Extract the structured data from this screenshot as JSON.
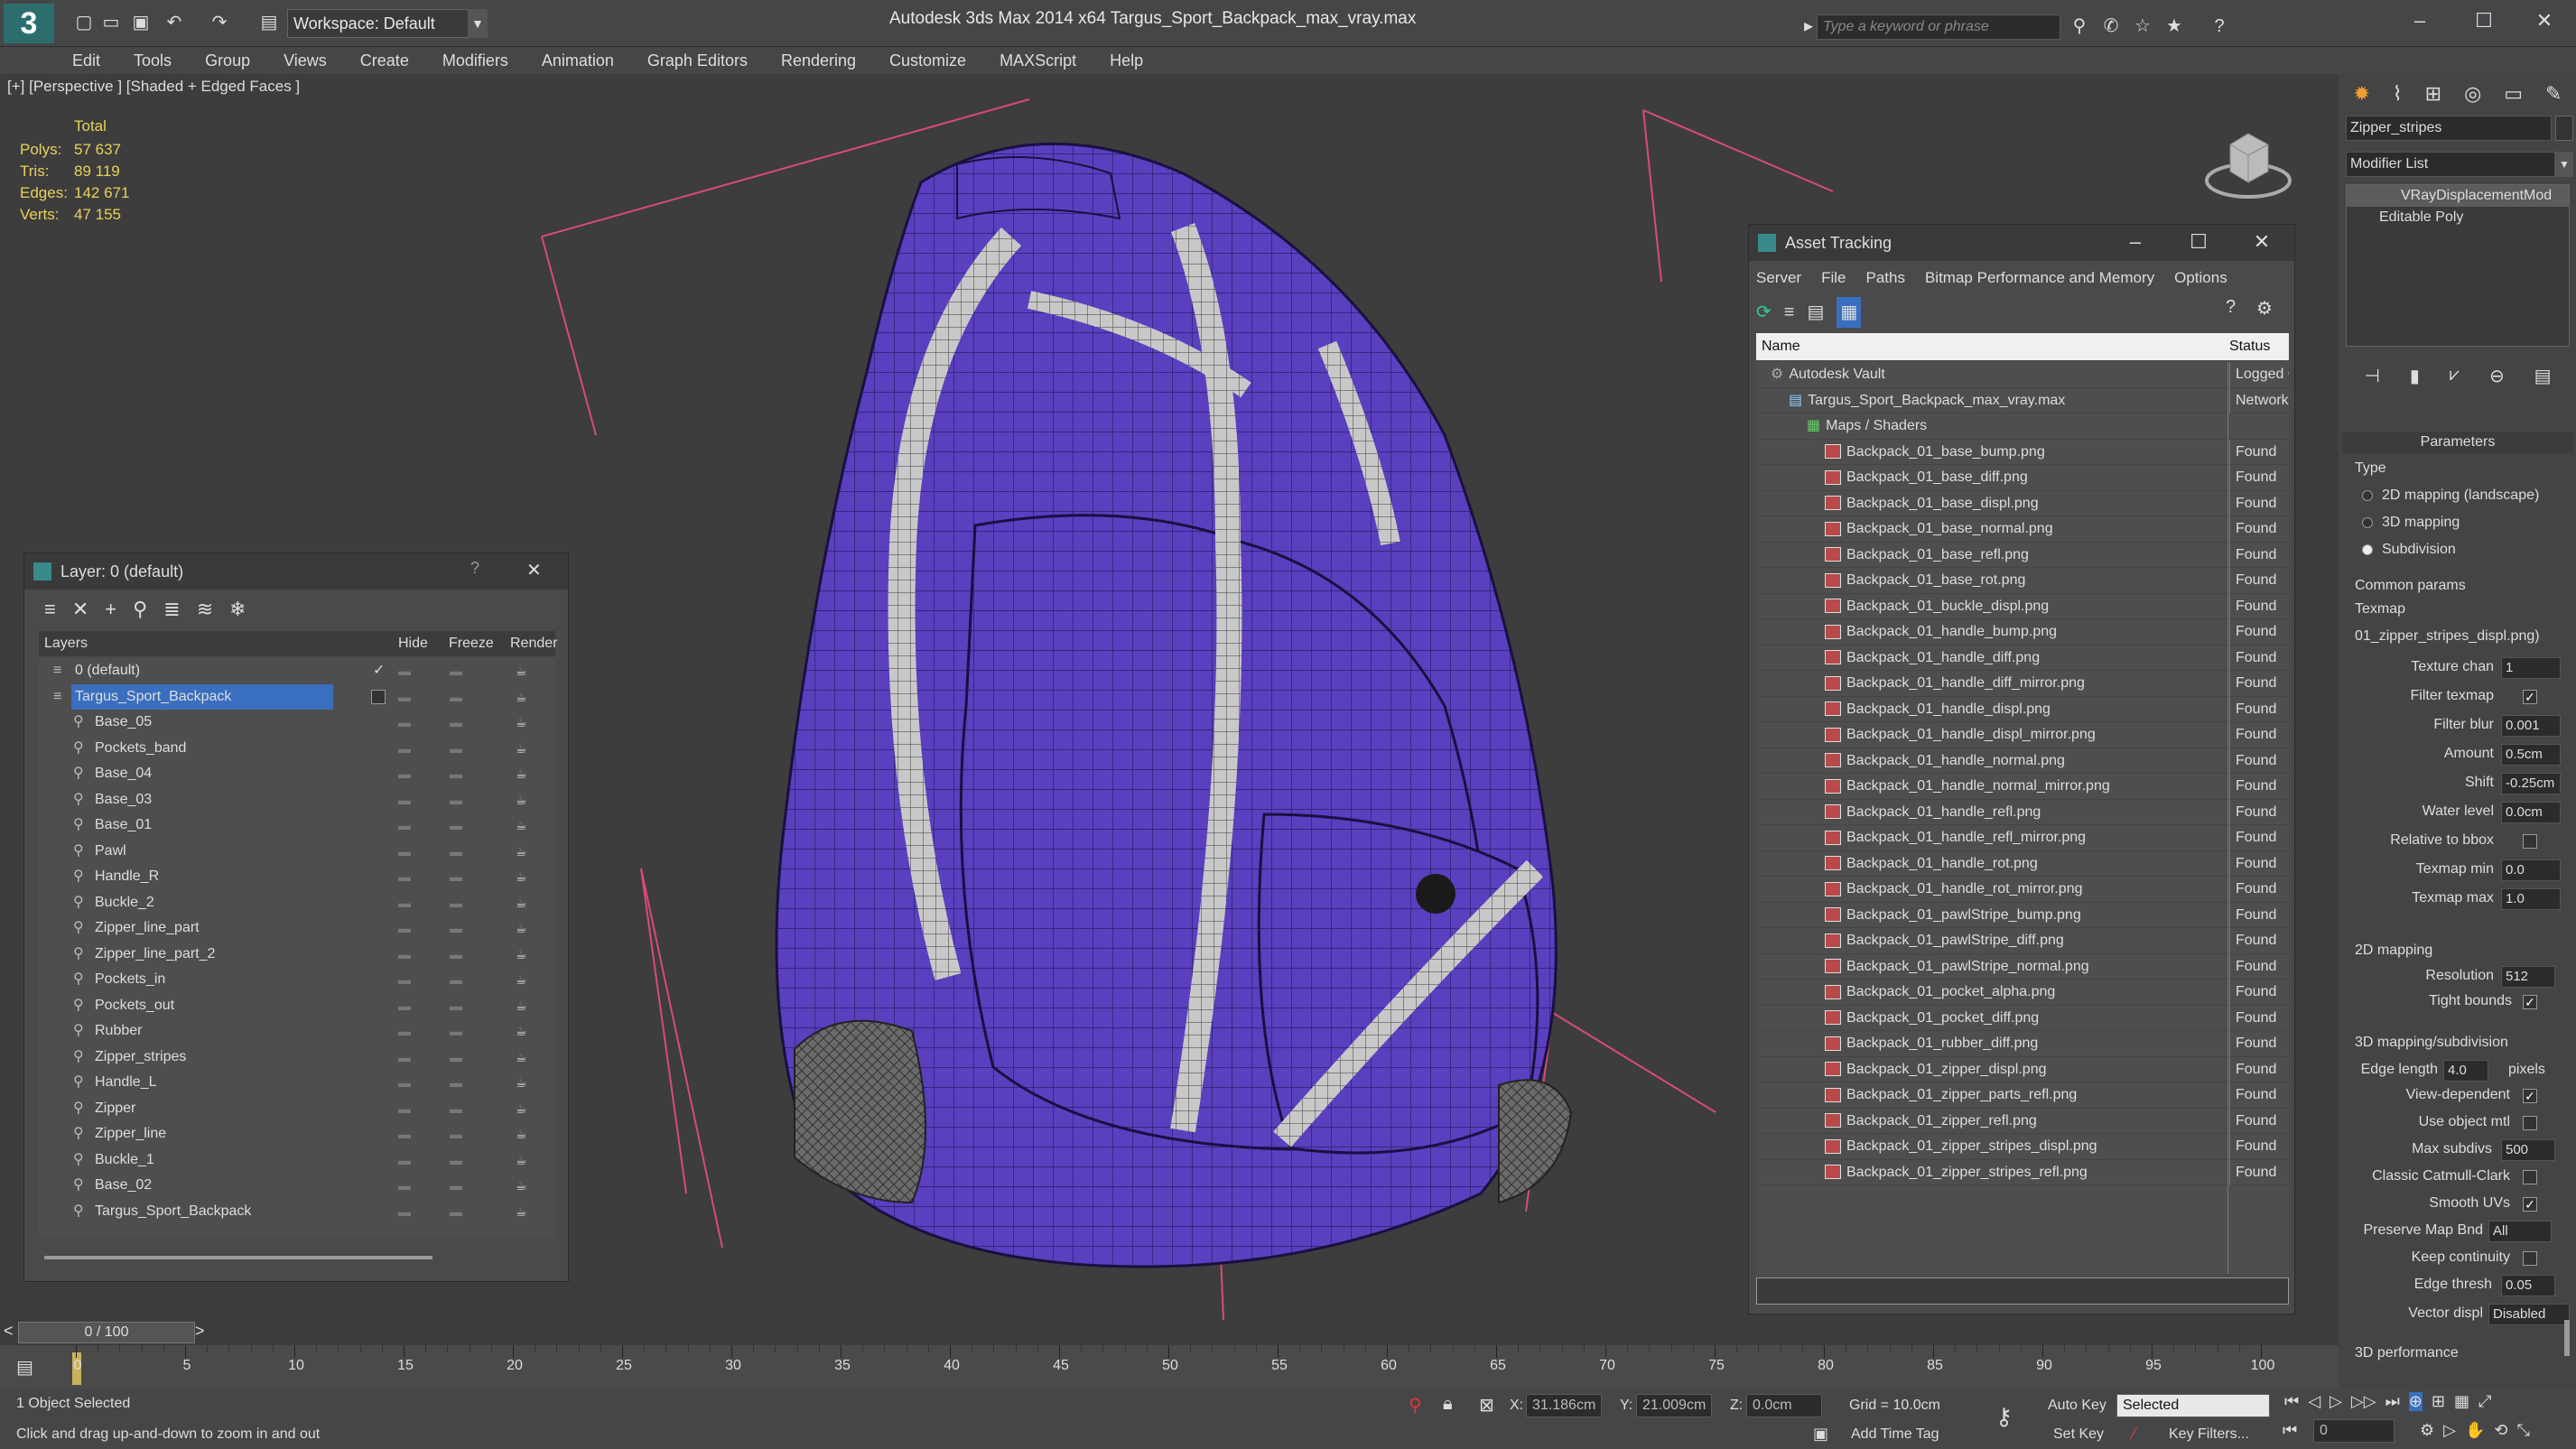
{
  "app": {
    "title": "Autodesk 3ds Max  2014 x64     Targus_Sport_Backpack_max_vray.max",
    "workspace": "Workspace: Default",
    "search_placeholder": "Type a keyword or phrase"
  },
  "menu": [
    "Edit",
    "Tools",
    "Group",
    "Views",
    "Create",
    "Modifiers",
    "Animation",
    "Graph Editors",
    "Rendering",
    "Customize",
    "MAXScript",
    "Help"
  ],
  "viewport": {
    "label": "[+] [Perspective ] [Shaded + Edged Faces ]",
    "stats_header": "Total",
    "stats": [
      {
        "label": "Polys:",
        "value": "57 637"
      },
      {
        "label": "Tris:",
        "value": "89 119"
      },
      {
        "label": "Edges:",
        "value": "142 671"
      },
      {
        "label": "Verts:",
        "value": "47 155"
      }
    ]
  },
  "layer_panel": {
    "title": "Layer: 0 (default)",
    "help": "?",
    "close": "✕",
    "columns": [
      "Layers",
      "Hide",
      "Freeze",
      "Render"
    ],
    "rows": [
      {
        "name": "0 (default)",
        "level": 0,
        "check": "✓"
      },
      {
        "name": "Targus_Sport_Backpack",
        "level": 0,
        "selected": true
      },
      {
        "name": "Base_05",
        "level": 1
      },
      {
        "name": "Pockets_band",
        "level": 1
      },
      {
        "name": "Base_04",
        "level": 1
      },
      {
        "name": "Base_03",
        "level": 1
      },
      {
        "name": "Base_01",
        "level": 1
      },
      {
        "name": "Pawl",
        "level": 1
      },
      {
        "name": "Handle_R",
        "level": 1
      },
      {
        "name": "Buckle_2",
        "level": 1
      },
      {
        "name": "Zipper_line_part",
        "level": 1
      },
      {
        "name": "Zipper_line_part_2",
        "level": 1
      },
      {
        "name": "Pockets_in",
        "level": 1
      },
      {
        "name": "Pockets_out",
        "level": 1
      },
      {
        "name": "Rubber",
        "level": 1
      },
      {
        "name": "Zipper_stripes",
        "level": 1
      },
      {
        "name": "Handle_L",
        "level": 1
      },
      {
        "name": "Zipper",
        "level": 1
      },
      {
        "name": "Zipper_line",
        "level": 1
      },
      {
        "name": "Buckle_1",
        "level": 1
      },
      {
        "name": "Base_02",
        "level": 1
      },
      {
        "name": "Targus_Sport_Backpack",
        "level": 1
      }
    ]
  },
  "asset_panel": {
    "title": "Asset Tracking",
    "menu": [
      "Server",
      "File",
      "Paths",
      "Bitmap Performance and Memory",
      "Options"
    ],
    "columns": [
      "Name",
      "Status"
    ],
    "rows": [
      {
        "name": "Autodesk Vault",
        "status": "Logged Ou",
        "level": 0
      },
      {
        "name": "Targus_Sport_Backpack_max_vray.max",
        "status": "Network Pa",
        "level": 1
      },
      {
        "name": "Maps / Shaders",
        "status": "",
        "level": 2
      },
      {
        "name": "Backpack_01_base_bump.png",
        "status": "Found",
        "level": 3
      },
      {
        "name": "Backpack_01_base_diff.png",
        "status": "Found",
        "level": 3
      },
      {
        "name": "Backpack_01_base_displ.png",
        "status": "Found",
        "level": 3
      },
      {
        "name": "Backpack_01_base_normal.png",
        "status": "Found",
        "level": 3
      },
      {
        "name": "Backpack_01_base_refl.png",
        "status": "Found",
        "level": 3
      },
      {
        "name": "Backpack_01_base_rot.png",
        "status": "Found",
        "level": 3
      },
      {
        "name": "Backpack_01_buckle_displ.png",
        "status": "Found",
        "level": 3
      },
      {
        "name": "Backpack_01_handle_bump.png",
        "status": "Found",
        "level": 3
      },
      {
        "name": "Backpack_01_handle_diff.png",
        "status": "Found",
        "level": 3
      },
      {
        "name": "Backpack_01_handle_diff_mirror.png",
        "status": "Found",
        "level": 3
      },
      {
        "name": "Backpack_01_handle_displ.png",
        "status": "Found",
        "level": 3
      },
      {
        "name": "Backpack_01_handle_displ_mirror.png",
        "status": "Found",
        "level": 3
      },
      {
        "name": "Backpack_01_handle_normal.png",
        "status": "Found",
        "level": 3
      },
      {
        "name": "Backpack_01_handle_normal_mirror.png",
        "status": "Found",
        "level": 3
      },
      {
        "name": "Backpack_01_handle_refl.png",
        "status": "Found",
        "level": 3
      },
      {
        "name": "Backpack_01_handle_refl_mirror.png",
        "status": "Found",
        "level": 3
      },
      {
        "name": "Backpack_01_handle_rot.png",
        "status": "Found",
        "level": 3
      },
      {
        "name": "Backpack_01_handle_rot_mirror.png",
        "status": "Found",
        "level": 3
      },
      {
        "name": "Backpack_01_pawlStripe_bump.png",
        "status": "Found",
        "level": 3
      },
      {
        "name": "Backpack_01_pawlStripe_diff.png",
        "status": "Found",
        "level": 3
      },
      {
        "name": "Backpack_01_pawlStripe_normal.png",
        "status": "Found",
        "level": 3
      },
      {
        "name": "Backpack_01_pocket_alpha.png",
        "status": "Found",
        "level": 3
      },
      {
        "name": "Backpack_01_pocket_diff.png",
        "status": "Found",
        "level": 3
      },
      {
        "name": "Backpack_01_rubber_diff.png",
        "status": "Found",
        "level": 3
      },
      {
        "name": "Backpack_01_zipper_displ.png",
        "status": "Found",
        "level": 3
      },
      {
        "name": "Backpack_01_zipper_parts_refl.png",
        "status": "Found",
        "level": 3
      },
      {
        "name": "Backpack_01_zipper_refl.png",
        "status": "Found",
        "level": 3
      },
      {
        "name": "Backpack_01_zipper_stripes_displ.png",
        "status": "Found",
        "level": 3
      },
      {
        "name": "Backpack_01_zipper_stripes_refl.png",
        "status": "Found",
        "level": 3
      }
    ]
  },
  "command_panel": {
    "object_name": "Zipper_stripes",
    "modifier_list": "Modifier List",
    "stack": [
      "VRayDisplacementMod",
      "Editable Poly"
    ],
    "parameters_title": "Parameters",
    "type_label": "Type",
    "type_options": [
      {
        "label": "2D mapping (landscape)",
        "checked": false
      },
      {
        "label": "3D mapping",
        "checked": false
      },
      {
        "label": "Subdivision",
        "checked": true
      }
    ],
    "common_params": "Common params",
    "texmap_label": "Texmap",
    "texmap_value": "01_zipper_stripes_displ.png)",
    "fields": [
      {
        "label": "Texture chan",
        "value": "1"
      },
      {
        "label": "Filter texmap",
        "check": "✓"
      },
      {
        "label": "Filter blur",
        "value": "0.001"
      },
      {
        "label": "Amount",
        "value": "0.5cm"
      },
      {
        "label": "Shift",
        "value": "-0.25cm"
      },
      {
        "label": "Water level",
        "value": "0.0cm"
      },
      {
        "label": "Relative to bbox",
        "check": ""
      },
      {
        "label": "Texmap min",
        "value": "0.0"
      },
      {
        "label": "Texmap max",
        "value": "1.0"
      }
    ],
    "mapping2d": "2D mapping",
    "resolution_label": "Resolution",
    "resolution_value": "512",
    "tight_bounds": "Tight bounds",
    "mapping3d": "3D mapping/subdivision",
    "edge_length_label": "Edge length",
    "edge_length_value": "4.0",
    "pixels": "pixels",
    "view_dependent": "View-dependent",
    "use_object_mtl": "Use object mtl",
    "max_subdivs_label": "Max subdivs",
    "max_subdivs_value": "500",
    "classic_catmull": "Classic Catmull-Clark",
    "smooth_uvs": "Smooth UVs",
    "preserve_map_bnd": "Preserve Map Bnd",
    "preserve_value": "All",
    "keep_continuity": "Keep continuity",
    "edge_thresh_label": "Edge thresh",
    "edge_thresh_value": "0.05",
    "vector_displ_label": "Vector displ",
    "vector_displ_value": "Disabled",
    "perf": "3D performance"
  },
  "timeline": {
    "frame": "0 / 100",
    "ticks": [
      "0",
      "5",
      "10",
      "15",
      "20",
      "25",
      "30",
      "35",
      "40",
      "45",
      "50",
      "55",
      "60",
      "65",
      "70",
      "75",
      "80",
      "85",
      "90",
      "95",
      "100"
    ]
  },
  "status": {
    "selected": "1 Object Selected",
    "hint": "Click and drag up-and-down to zoom in and out",
    "x_label": "X:",
    "x_value": "31.186cm",
    "y_label": "Y:",
    "y_value": "21.009cm",
    "z_label": "Z:",
    "z_value": "0.0cm",
    "grid": "Grid = 10.0cm",
    "add_time_tag": "Add Time Tag",
    "auto_key": "Auto Key",
    "set_key": "Set Key",
    "selected_dropdown": "Selected",
    "key_filters": "Key Filters...",
    "frame_field": "0"
  },
  "colors": {
    "backpack": "#5a3fbf",
    "selected": "#3a6fbf",
    "stats": "#e8d25a",
    "camera_lines": "#d84b7a"
  }
}
